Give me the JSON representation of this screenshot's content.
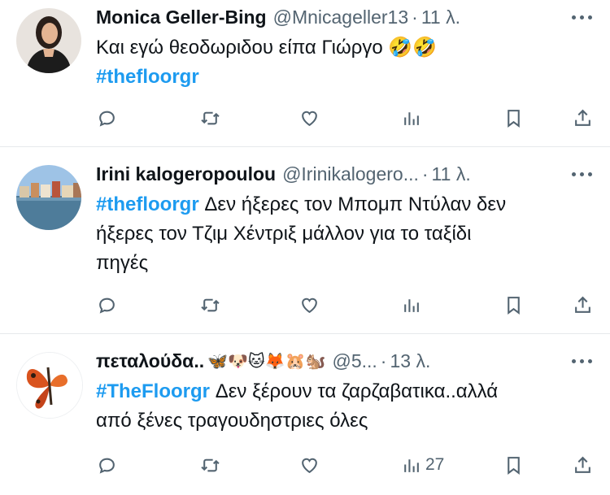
{
  "tweets": [
    {
      "name": "Monica Geller-Bing",
      "handle": "@Mnicageller13",
      "time": "11 λ.",
      "text_lines": [
        "Και εγώ θεοδωριδου είπα Γιώργο 🤣🤣"
      ],
      "hashtag": "#thefloorgr",
      "views": ""
    },
    {
      "name": "Irini kalogeropoulou",
      "handle": "@Irinikalogero...",
      "time": "11 λ.",
      "hashtag": "#thefloorgr",
      "text_line1": "Δεν ήξερες τον Μπομπ Ντύλαν δεν",
      "text_line2": "ήξερες τον Τζιμ Χέντριξ μάλλον για το ταξίδι",
      "text_line3": "πηγές",
      "views": ""
    },
    {
      "name": "πεταλούδα..",
      "name_emojis": "🦋🐶🐱🦊🐹🐿️",
      "handle": "@5...",
      "time": "13 λ.",
      "hashtag": "#TheFloorgr",
      "text_line1": "Δεν ξέρουν τα ζαρζαβατικα..αλλά",
      "text_line2": "από ξένες τραγουδηστριες όλες",
      "views": "27"
    }
  ],
  "icons": {
    "reply": "reply-icon",
    "retweet": "retweet-icon",
    "like": "heart-icon",
    "views": "views-icon",
    "bookmark": "bookmark-icon",
    "share": "share-icon",
    "more": "more-icon"
  },
  "colors": {
    "hashtag": "#1d9bf0",
    "secondary_text": "#536471",
    "divider": "#e6e9ec"
  }
}
